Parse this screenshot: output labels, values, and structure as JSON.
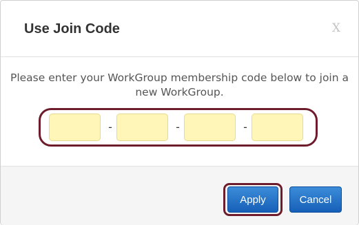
{
  "dialog": {
    "title": "Use Join Code",
    "close_label": "X",
    "message": "Please enter your WorkGroup membership code below to join a new WorkGroup.",
    "code_fields": [
      {
        "value": "",
        "placeholder": ""
      },
      {
        "value": "",
        "placeholder": ""
      },
      {
        "value": "",
        "placeholder": ""
      },
      {
        "value": "",
        "placeholder": ""
      }
    ],
    "separator": "-",
    "apply_label": "Apply",
    "cancel_label": "Cancel"
  },
  "colors": {
    "input_background": "#fff6b8",
    "button_blue": "#1f6fc6",
    "highlight_ring": "#6e1b2c",
    "footer_background": "#f5f5f5"
  }
}
